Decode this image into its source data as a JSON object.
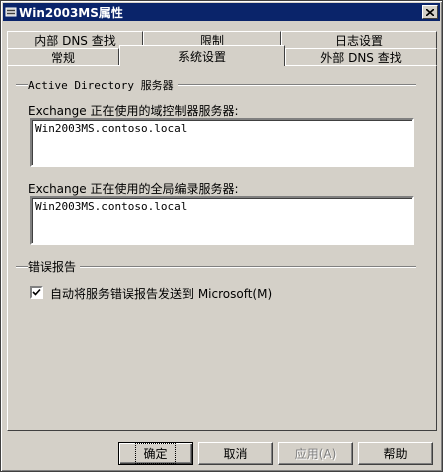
{
  "window": {
    "title": "Win2003MS属性"
  },
  "tabs": {
    "back": [
      "内部 DNS 查找",
      "限制",
      "日志设置"
    ],
    "front": [
      "常规",
      "系统设置",
      "外部 DNS 查找"
    ],
    "active": "系统设置"
  },
  "ad_group": {
    "label": "Active Directory 服务器",
    "dc_label": "Exchange 正在使用的域控制器服务器:",
    "dc_value": "Win2003MS.contoso.local",
    "gc_label": "Exchange 正在使用的全局编录服务器:",
    "gc_value": "Win2003MS.contoso.local"
  },
  "error_group": {
    "label": "错误报告",
    "checkbox_label": "自动将服务错误报告发送到 Microsoft(M)",
    "checked": true
  },
  "buttons": {
    "ok": "确定",
    "cancel": "取消",
    "apply": "应用(A)",
    "help": "帮助"
  }
}
